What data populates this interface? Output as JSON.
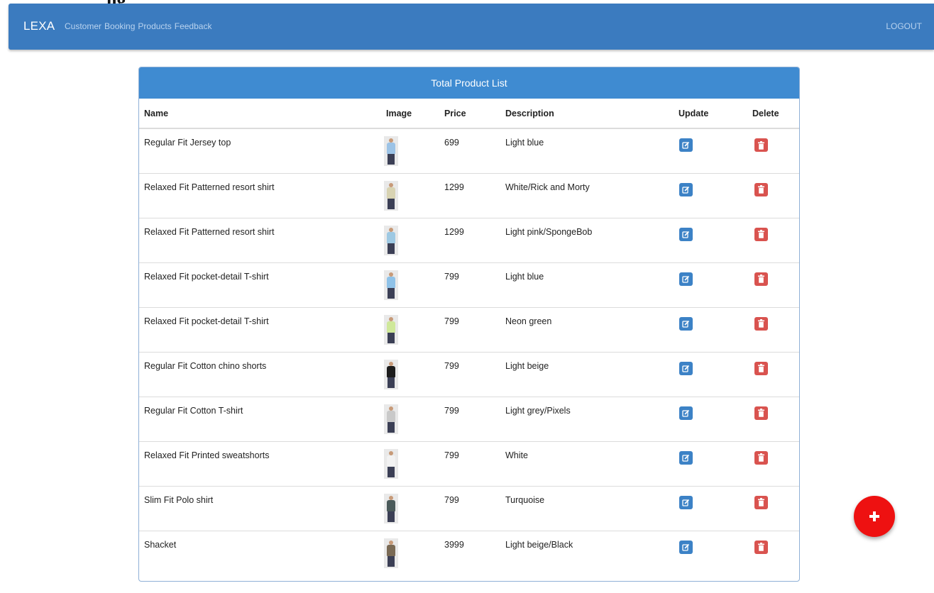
{
  "navbar": {
    "brand": "LEXA",
    "links": [
      "Customer",
      "Booking",
      "Products",
      "Feedback"
    ],
    "logout": "LOGOUT",
    "background_color": "#3b7bbf"
  },
  "panel": {
    "title": "Total Product List",
    "header_color": "#3f8bd1"
  },
  "table": {
    "columns": [
      "Name",
      "Image",
      "Price",
      "Description",
      "Update",
      "Delete"
    ],
    "rows": [
      {
        "name": "Regular Fit Jersey top",
        "price": "699",
        "description": "Light blue",
        "image": "product-photo",
        "shirt_color": "#9cc3e6"
      },
      {
        "name": "Relaxed Fit Patterned resort shirt",
        "price": "1299",
        "description": "White/Rick and Morty",
        "image": "product-photo",
        "shirt_color": "#d8d3b2"
      },
      {
        "name": "Relaxed Fit Patterned resort shirt",
        "price": "1299",
        "description": "Light pink/SpongeBob",
        "image": "product-photo",
        "shirt_color": "#9ec9e3"
      },
      {
        "name": "Relaxed Fit pocket-detail T-shirt",
        "price": "799",
        "description": "Light blue",
        "image": "product-photo",
        "shirt_color": "#8fc2e8"
      },
      {
        "name": "Relaxed Fit pocket-detail T-shirt",
        "price": "799",
        "description": "Neon green",
        "image": "product-photo",
        "shirt_color": "#cfe89a"
      },
      {
        "name": "Regular Fit Cotton chino shorts",
        "price": "799",
        "description": "Light beige",
        "image": "product-photo",
        "shirt_color": "#1c1c1c"
      },
      {
        "name": "Regular Fit Cotton T-shirt",
        "price": "799",
        "description": "Light grey/Pixels",
        "image": "product-photo",
        "shirt_color": "#c9c9c9"
      },
      {
        "name": "Relaxed Fit Printed sweatshorts",
        "price": "799",
        "description": "White",
        "image": "product-photo",
        "shirt_color": "#f2f2f2"
      },
      {
        "name": "Slim Fit Polo shirt",
        "price": "799",
        "description": "Turquoise",
        "image": "product-photo",
        "shirt_color": "#4a5a5a"
      },
      {
        "name": "Shacket",
        "price": "3999",
        "description": "Light beige/Black",
        "image": "product-photo",
        "shirt_color": "#7a6a55"
      }
    ]
  },
  "icons": {
    "update": "edit-icon",
    "delete": "trash-icon",
    "add": "plus-icon"
  },
  "colors": {
    "update_button": "#3c82c6",
    "delete_button": "#d9534f",
    "fab": "#ee1111"
  }
}
